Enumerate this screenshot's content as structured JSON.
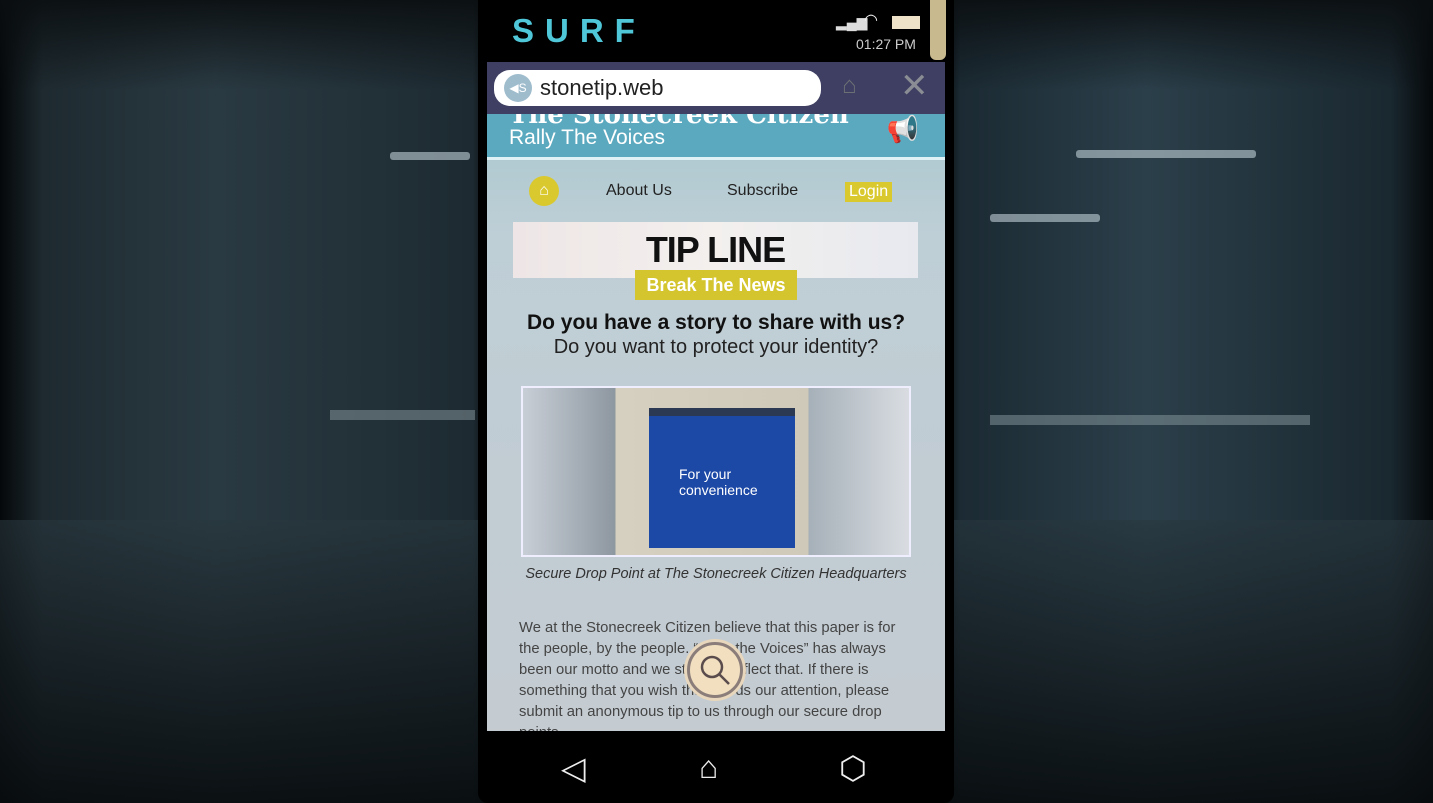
{
  "app": {
    "title": "SURF",
    "time": "01:27 PM"
  },
  "browser": {
    "url": "stonetip.web",
    "home_icon": "home-icon",
    "close_icon": "close-icon"
  },
  "site": {
    "name": "The Stonecreek Citizen",
    "tagline": "Rally The Voices",
    "nav": [
      "About Us",
      "Subscribe",
      "Login"
    ],
    "banner_title": "TIP LINE",
    "banner_button": "Break The News",
    "question1": "Do you have a story to share with us?",
    "question2": "Do you want to protect your identity?",
    "photo_text": "For your convenience",
    "caption": "Secure Drop Point at The Stonecreek Citizen Headquarters",
    "paragraph": "We at the Stonecreek Citizen believe that this paper is for the people, by the people. “Rally the Voices” has always been our motto and we strive to reflect that. If there is something that you wish that needs our attention, please submit an anonymous tip to us through our secure drop points."
  },
  "colors": {
    "accent": "#4fc7d8",
    "masthead": "#5ba9bf",
    "yellow": "#d9c92e"
  }
}
